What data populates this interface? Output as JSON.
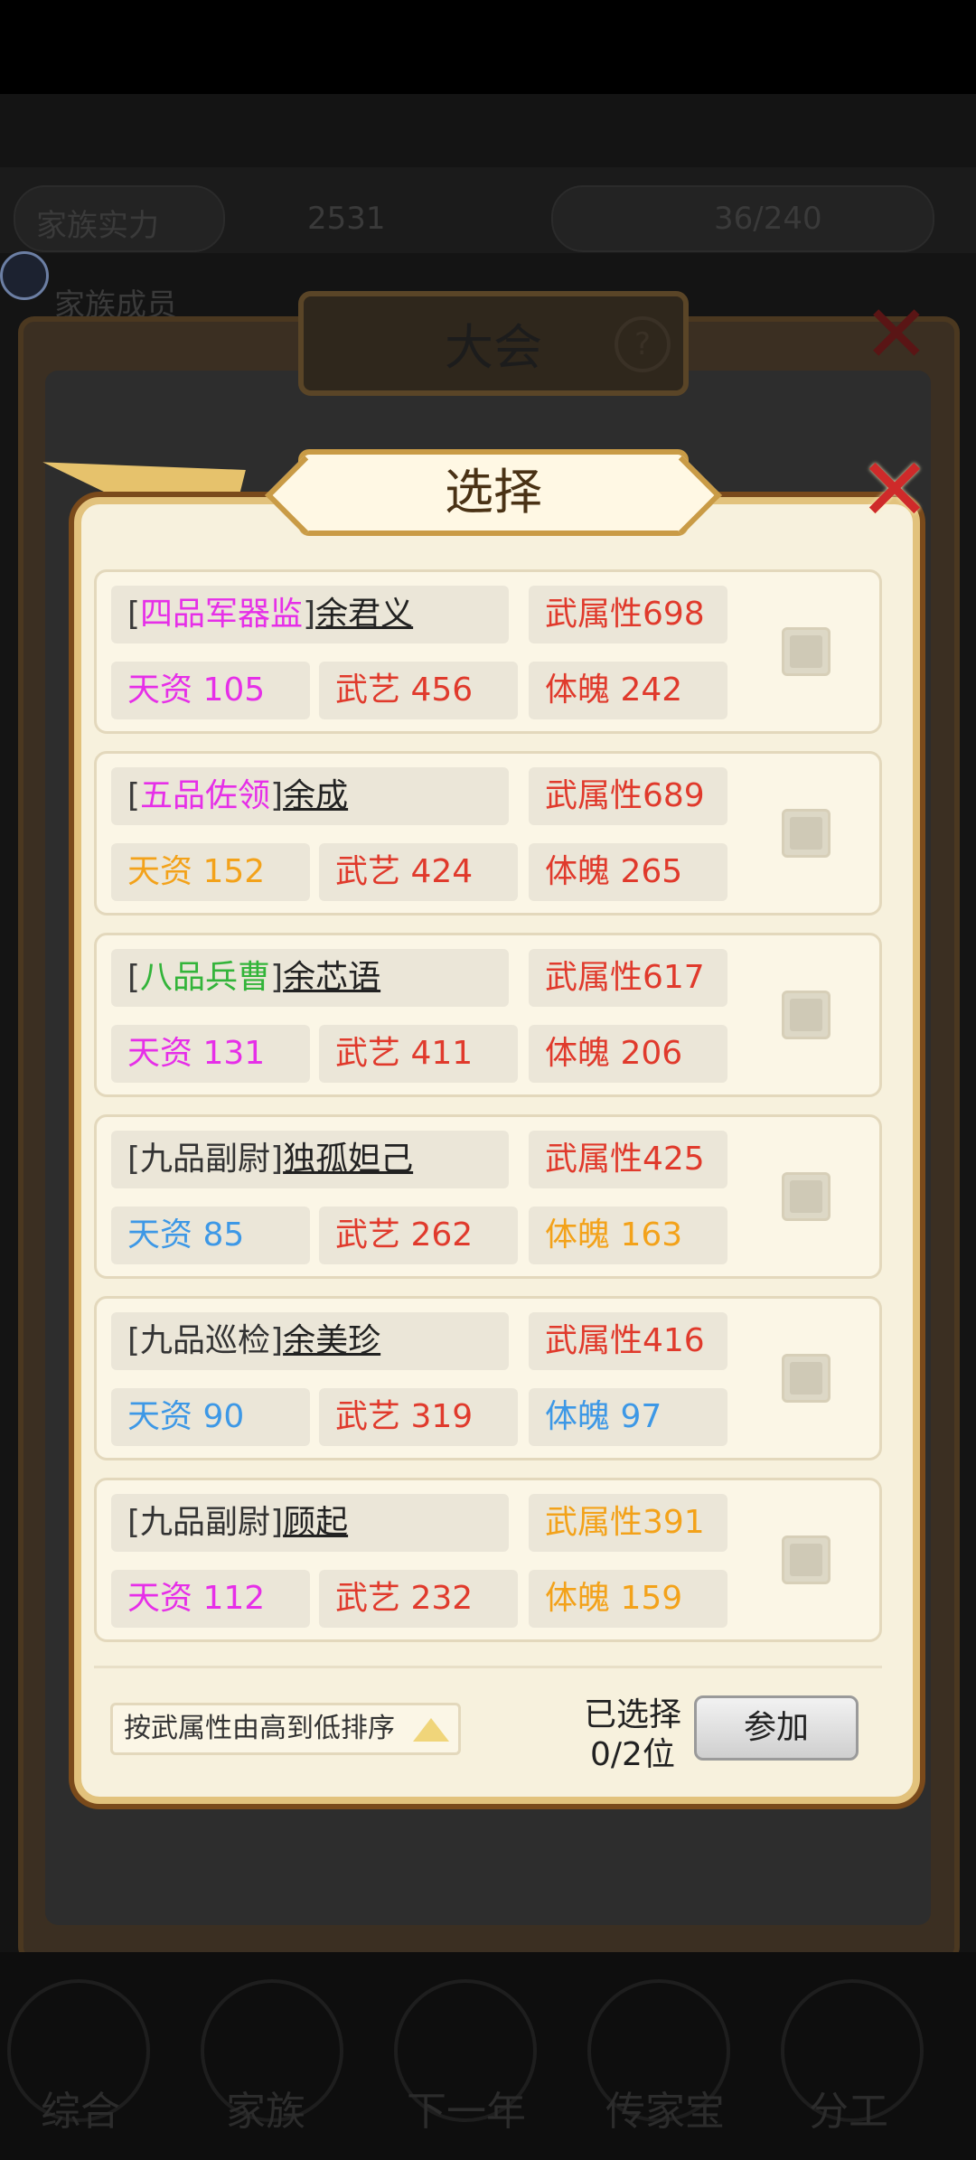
{
  "background": {
    "hud_items": [
      "家族实力",
      "2531",
      "36/240"
    ],
    "side_label": "家族成员",
    "outer_title": "大会",
    "bottom_nav": [
      "综合",
      "家族",
      "下一年",
      "传家宝",
      "分工"
    ]
  },
  "dialog": {
    "title": "选择",
    "close_label": "✕"
  },
  "colors": {
    "magenta": "#e62fe8",
    "orange": "#f3a21a",
    "green": "#33b43a",
    "blue": "#3d98e6",
    "red": "#e03a2c",
    "gray": "#333333"
  },
  "candidates": [
    {
      "rank": "四品军器监",
      "rank_color": "magenta",
      "name": "余君义",
      "attr": "武属性698",
      "attr_color": "red",
      "aptitude": "天资 105",
      "aptitude_color": "magenta",
      "skill": "武艺 456",
      "skill_color": "red",
      "physique": "体魄 242",
      "physique_color": "red",
      "selected": false
    },
    {
      "rank": "五品佐领",
      "rank_color": "magenta",
      "name": "余成",
      "attr": "武属性689",
      "attr_color": "red",
      "aptitude": "天资 152",
      "aptitude_color": "orange",
      "skill": "武艺 424",
      "skill_color": "red",
      "physique": "体魄 265",
      "physique_color": "red",
      "selected": false
    },
    {
      "rank": "八品兵曹",
      "rank_color": "green",
      "name": "余芯语",
      "attr": "武属性617",
      "attr_color": "red",
      "aptitude": "天资 131",
      "aptitude_color": "magenta",
      "skill": "武艺 411",
      "skill_color": "red",
      "physique": "体魄 206",
      "physique_color": "red",
      "selected": false
    },
    {
      "rank": "九品副尉",
      "rank_color": "gray",
      "name": "独孤妲己",
      "attr": "武属性425",
      "attr_color": "red",
      "aptitude": "天资 85",
      "aptitude_color": "blue",
      "skill": "武艺 262",
      "skill_color": "red",
      "physique": "体魄 163",
      "physique_color": "orange",
      "selected": false
    },
    {
      "rank": "九品巡检",
      "rank_color": "gray",
      "name": "余美珍",
      "attr": "武属性416",
      "attr_color": "red",
      "aptitude": "天资 90",
      "aptitude_color": "blue",
      "skill": "武艺 319",
      "skill_color": "red",
      "physique": "体魄 97",
      "physique_color": "blue",
      "selected": false
    },
    {
      "rank": "九品副尉",
      "rank_color": "gray",
      "name": "顾起",
      "attr": "武属性391",
      "attr_color": "orange",
      "aptitude": "天资 112",
      "aptitude_color": "magenta",
      "skill": "武艺 232",
      "skill_color": "red",
      "physique": "体魄 159",
      "physique_color": "orange",
      "selected": false
    }
  ],
  "footer": {
    "sort_label": "按武属性由高到低排序",
    "selected_label": "已选择",
    "selected_count": "0/2位",
    "join_label": "参加"
  }
}
